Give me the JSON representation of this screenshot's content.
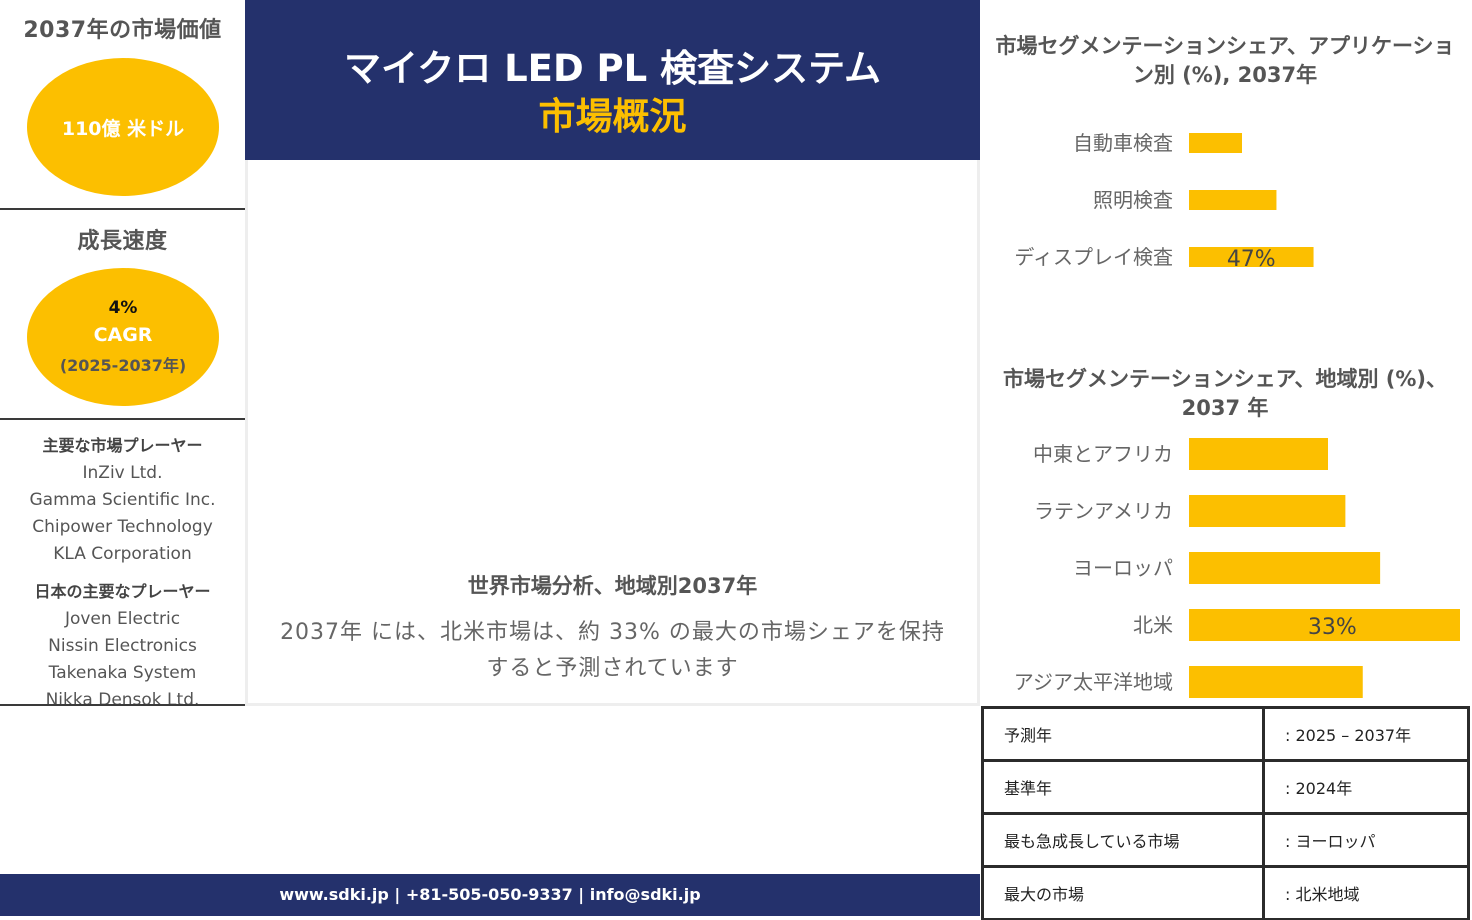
{
  "left": {
    "market_value_title": "2037年の市場価値",
    "market_value": "110億 米ドル",
    "growth_title": "成長速度",
    "cagr_value": "4%",
    "cagr_label": "CAGR",
    "cagr_period": "(2025-2037年)",
    "players_heading": "主要な市場プレーヤー",
    "players": [
      "InZiv Ltd.",
      "Gamma Scientific Inc.",
      "Chipower Technology",
      "KLA Corporation"
    ],
    "jp_players_heading": "日本の主要なプレーヤー",
    "jp_players": [
      "Joven Electric",
      "Nissin Electronics",
      "Takenaka System",
      "Nikka Densok Ltd."
    ]
  },
  "header": {
    "title": "マイクロ LED PL 検査システム",
    "subtitle": "市場概況"
  },
  "center": {
    "subtitle": "世界市場分析、地域別2037年",
    "description": "2037年 には、北米市場は、約 33% の最大の市場シェアを保持すると予測されています"
  },
  "footer": {
    "contact": "www.sdki.jp | +81-505-050-9337 | info@sdki.jp"
  },
  "colors": {
    "navy": "#24316C",
    "accent": "#FCBF00",
    "text": "#555555"
  },
  "chart_data": [
    {
      "type": "bar",
      "orientation": "horizontal",
      "title": "市場セグメンテーションシェア、アプリケーション別 (%), 2037年",
      "categories": [
        "自動車検査",
        "照明検査",
        "ディスプレイ検査"
      ],
      "values": [
        20,
        33,
        47
      ],
      "data_labels": [
        "",
        "",
        "47%"
      ],
      "xlim": [
        0,
        100
      ]
    },
    {
      "type": "bar",
      "orientation": "horizontal",
      "title": "市場セグメンテーションシェア、地域別 (%)、2037 年",
      "categories": [
        "中東とアフリカ",
        "ラテンアメリカ",
        "ヨーロッパ",
        "北米",
        "アジア太平洋地域"
      ],
      "values": [
        16,
        18,
        22,
        33,
        20
      ],
      "data_labels": [
        "",
        "",
        "",
        "33%",
        ""
      ],
      "xlim": [
        0,
        48
      ]
    }
  ],
  "info_table": [
    {
      "key": "予測年",
      "value": ": 2025 – 2037年"
    },
    {
      "key": "基準年",
      "value": ": 2024年"
    },
    {
      "key": "最も急成長している市場",
      "value": ": ヨーロッパ"
    },
    {
      "key": "最大の市場",
      "value": ": 北米地域"
    }
  ]
}
